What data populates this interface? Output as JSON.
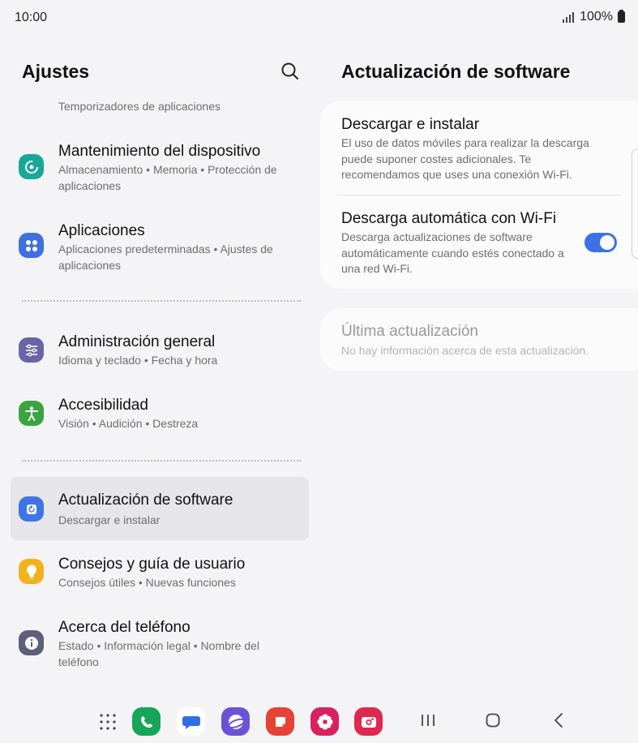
{
  "status": {
    "time": "10:00",
    "battery": "100%"
  },
  "left": {
    "title": "Ajustes",
    "top_subtext": "Temporizadores de aplicaciones",
    "items": [
      {
        "title": "Mantenimiento del dispositivo",
        "sub": "Almacenamiento  •  Memoria  •  Protección de aplicaciones",
        "icon": "device-care-icon",
        "color": "#18a89a"
      },
      {
        "title": "Aplicaciones",
        "sub": "Aplicaciones predeterminadas  •  Ajustes de aplicaciones",
        "icon": "apps-icon",
        "color": "#3f6fe0"
      },
      {
        "title": "Administración general",
        "sub": "Idioma y teclado  •  Fecha y hora",
        "icon": "sliders-icon",
        "color": "#6a64a8"
      },
      {
        "title": "Accesibilidad",
        "sub": "Visión  •  Audición  •  Destreza",
        "icon": "accessibility-icon",
        "color": "#3aa540"
      },
      {
        "title": "Actualización de software",
        "sub": "Descargar e instalar",
        "icon": "software-update-icon",
        "color": "#3f74e4"
      },
      {
        "title": "Consejos y guía de usuario",
        "sub": "Consejos útiles  •  Nuevas funciones",
        "icon": "lightbulb-icon",
        "color": "#f2b21c"
      },
      {
        "title": "Acerca del teléfono",
        "sub": "Estado  •  Información legal  •  Nombre del teléfono",
        "icon": "info-icon",
        "color": "#5e5f78"
      }
    ]
  },
  "right": {
    "title": "Actualización de software",
    "download": {
      "title": "Descargar e instalar",
      "desc": "El uso de datos móviles para realizar la descarga puede suponer costes adicionales. Te recomendamos que uses una conexión Wi-Fi."
    },
    "auto_wifi": {
      "title": "Descarga automática con Wi-Fi",
      "desc": "Descarga actualizaciones de software automáticamente cuando estés conectado a una red Wi-Fi.",
      "enabled": true
    },
    "last_update": {
      "title": "Última actualización",
      "desc": "No hay información acerca de esta actualización."
    }
  },
  "dock": {
    "apps": [
      {
        "name": "phone-app-icon",
        "color": "#15a65a"
      },
      {
        "name": "messages-app-icon",
        "color": "#2f6fe6"
      },
      {
        "name": "internet-app-icon",
        "color": "#6a52d9"
      },
      {
        "name": "notes-app-icon",
        "color": "#e54336"
      },
      {
        "name": "gallery-app-icon",
        "color": "#d8215e"
      },
      {
        "name": "camera-app-icon",
        "color": "#e0284e"
      }
    ]
  }
}
